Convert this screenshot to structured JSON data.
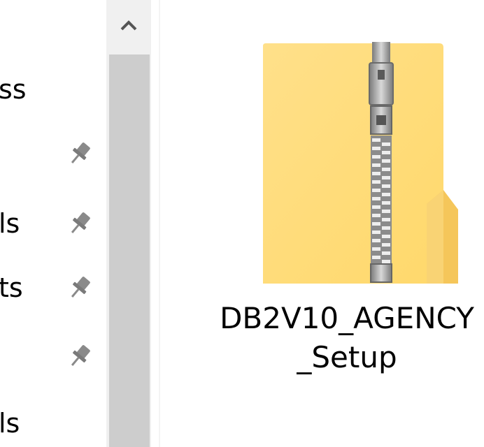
{
  "nav": {
    "items": [
      {
        "label": "ss",
        "pinned": false
      },
      {
        "label": "",
        "pinned": true
      },
      {
        "label": "ls",
        "pinned": true
      },
      {
        "label": "ts",
        "pinned": true
      },
      {
        "label": "",
        "pinned": true
      },
      {
        "label": "ls",
        "pinned": false
      }
    ]
  },
  "scrollbar": {
    "up_icon": "chevron-up-icon"
  },
  "file": {
    "icon": "zip-folder-icon",
    "name_line1": "DB2V10_AGENCY",
    "name_line2": "_Setup"
  },
  "colors": {
    "folder_body": "#FFE08A",
    "folder_back": "#F5C65A",
    "zipper": "#9E9E9E",
    "scroll_thumb": "#CDCDCD",
    "scroll_track": "#F0F0F0"
  }
}
